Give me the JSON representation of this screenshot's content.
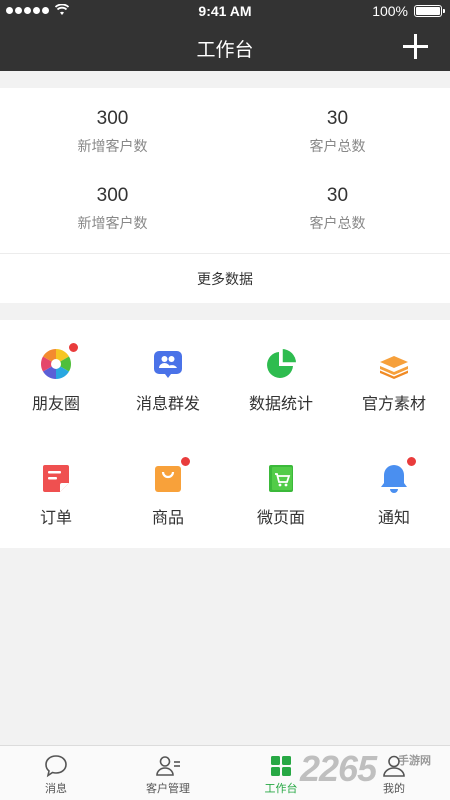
{
  "status_bar": {
    "time": "9:41 AM",
    "battery": "100%",
    "battery_level": 1.0
  },
  "nav": {
    "title": "工作台"
  },
  "stats": [
    {
      "value": "300",
      "label": "新增客户数"
    },
    {
      "value": "30",
      "label": "客户总数"
    },
    {
      "value": "300",
      "label": "新增客户数"
    },
    {
      "value": "30",
      "label": "客户总数"
    }
  ],
  "more_data": "更多数据",
  "tools": [
    {
      "label": "朋友圈",
      "icon": "aperture-icon",
      "badge": true
    },
    {
      "label": "消息群发",
      "icon": "group-chat-icon",
      "badge": false
    },
    {
      "label": "数据统计",
      "icon": "pie-chart-icon",
      "badge": false
    },
    {
      "label": "官方素材",
      "icon": "layers-icon",
      "badge": false
    },
    {
      "label": "订单",
      "icon": "order-icon",
      "badge": false
    },
    {
      "label": "商品",
      "icon": "bag-icon",
      "badge": true
    },
    {
      "label": "微页面",
      "icon": "cart-page-icon",
      "badge": false
    },
    {
      "label": "通知",
      "icon": "bell-icon",
      "badge": true
    }
  ],
  "tabbar": {
    "items": [
      {
        "label": "消息",
        "icon": "chat-bubble-icon"
      },
      {
        "label": "客户管理",
        "icon": "user-list-icon"
      },
      {
        "label": "工作台",
        "icon": "grid-icon",
        "active": true
      },
      {
        "label": "我的",
        "icon": "person-icon"
      }
    ]
  },
  "watermark": {
    "big": "2265",
    "small": "手游网"
  },
  "colors": {
    "header": "#333333",
    "accent": "#27a844",
    "badge": "#e93c3c"
  }
}
